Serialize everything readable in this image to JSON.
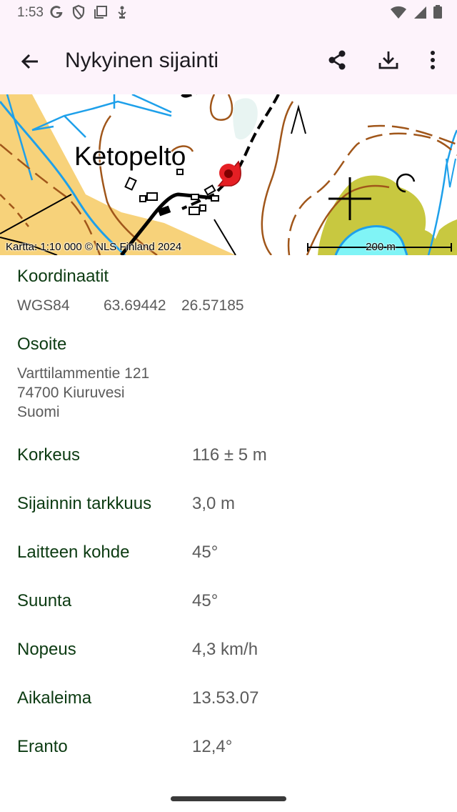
{
  "status_bar": {
    "time": "1:53",
    "left_icons": [
      "google-icon",
      "shield-icon",
      "screen-icon",
      "usb-debug-icon"
    ],
    "right_icons": [
      "wifi-icon",
      "signal-icon",
      "battery-icon"
    ]
  },
  "app_bar": {
    "title": "Nykyinen sijainti",
    "actions": [
      "share-icon",
      "download-icon",
      "more-vert-icon"
    ]
  },
  "map": {
    "place_label": "Ketopelto",
    "attribution": "Kartta: 1:10 000 © NLS Finland 2024",
    "scale_label": "200 m"
  },
  "coordinates": {
    "title": "Koordinaatit",
    "system": "WGS84",
    "lat": "63.69442",
    "lon": "26.57185"
  },
  "address": {
    "title": "Osoite",
    "lines": [
      "Varttilammentie 121",
      "74700 Kiuruvesi",
      "Suomi"
    ]
  },
  "properties": [
    {
      "label": "Korkeus",
      "value": "116 ± 5 m"
    },
    {
      "label": "Sijainnin tarkkuus",
      "value": "3,0 m"
    },
    {
      "label": "Laitteen kohde",
      "value": "45°"
    },
    {
      "label": "Suunta",
      "value": "45°"
    },
    {
      "label": "Nopeus",
      "value": "4,3 km/h"
    },
    {
      "label": "Aikaleima",
      "value": "13.53.07"
    },
    {
      "label": "Eranto",
      "value": "12,4°"
    }
  ],
  "colors": {
    "app_bar_bg": "#fdf3fb",
    "label_green": "#0c3b12",
    "value_gray": "#5b5b5b",
    "map_field": "#f7d27a",
    "map_water": "#80f4f6",
    "map_olive": "#c8c840",
    "map_contour": "#a0561a",
    "map_stream": "#1ea0ea",
    "location_marker": "#e51f24"
  }
}
